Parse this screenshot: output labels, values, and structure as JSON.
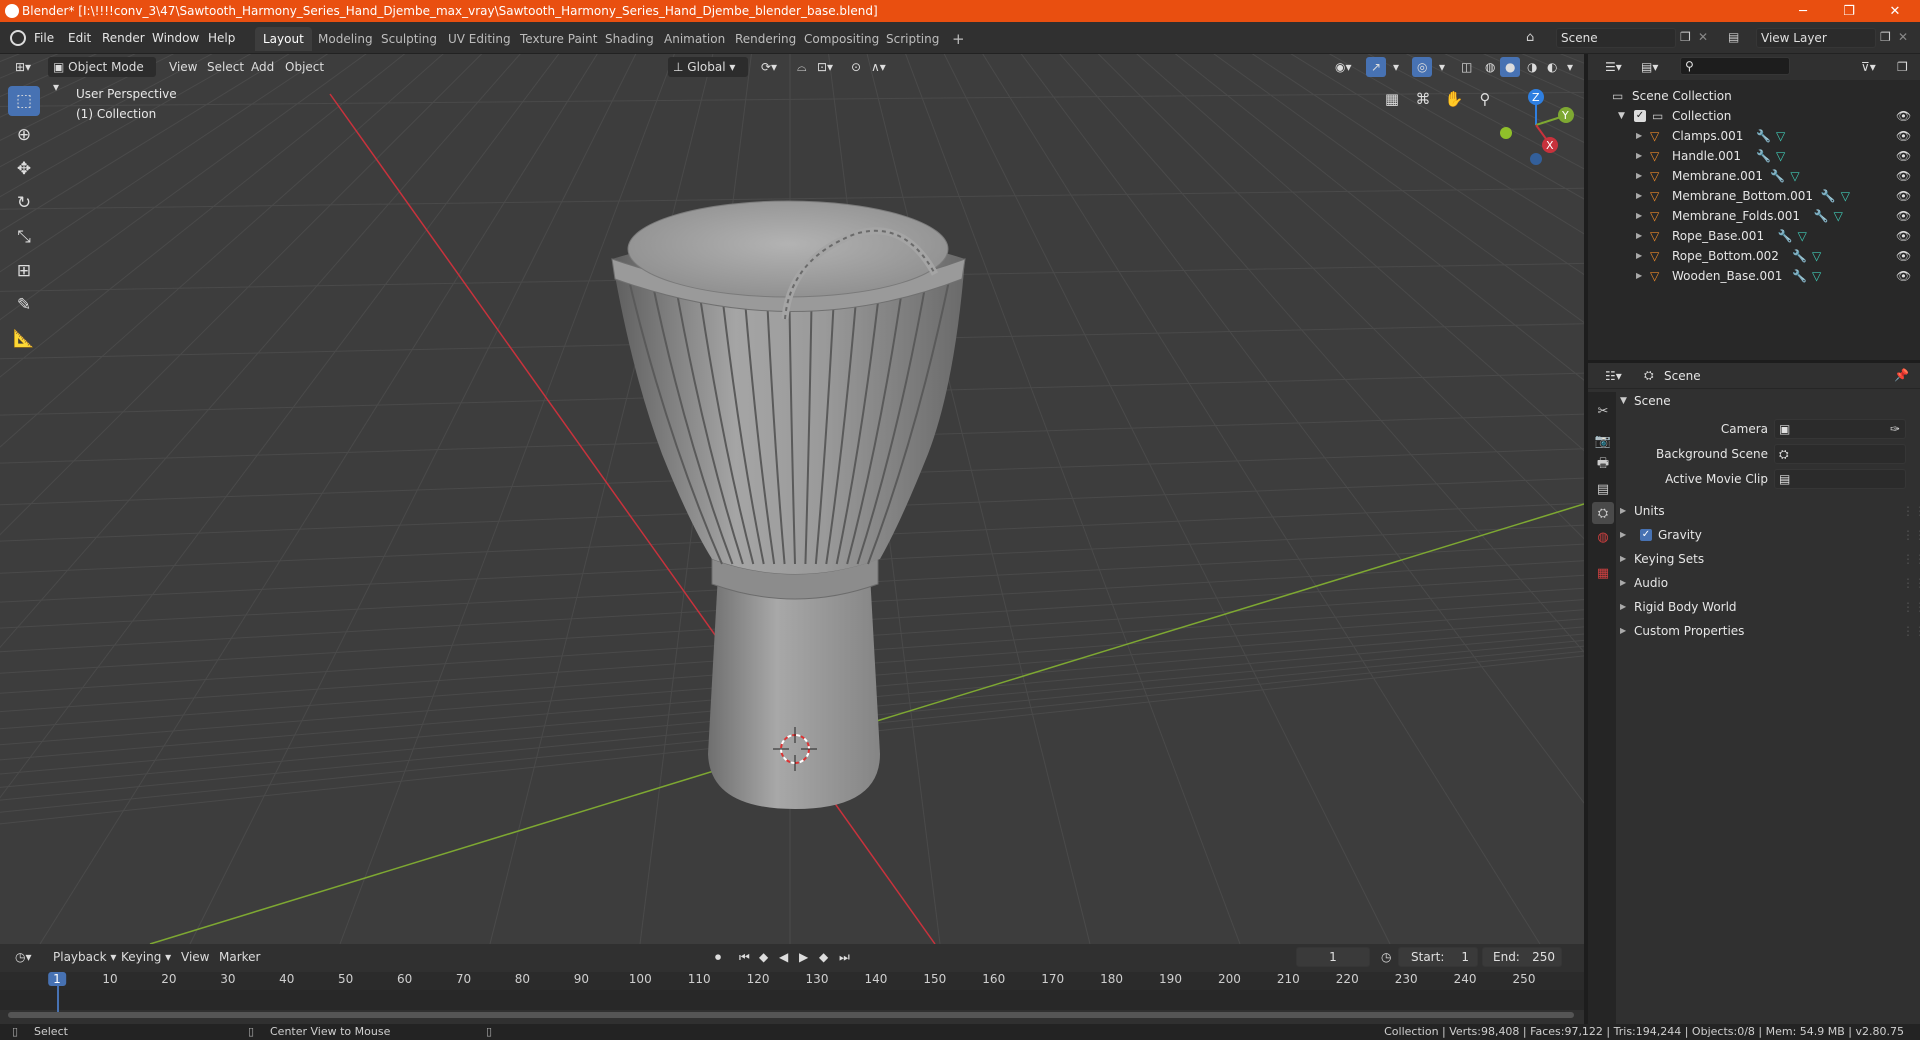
{
  "window": {
    "title": "Blender* [I:\\!!!!conv_3\\47\\Sawtooth_Harmony_Series_Hand_Djembe_max_vray\\Sawtooth_Harmony_Series_Hand_Djembe_blender_base.blend]",
    "minimize": "─",
    "maximize": "❐",
    "close": "✕"
  },
  "menus": [
    "File",
    "Edit",
    "Render",
    "Window",
    "Help"
  ],
  "workspaces": [
    "Layout",
    "Modeling",
    "Sculpting",
    "UV Editing",
    "Texture Paint",
    "Shading",
    "Animation",
    "Rendering",
    "Compositing",
    "Scripting"
  ],
  "add_workspace": "+",
  "scene_field": "Scene",
  "view_layer_field": "View Layer",
  "viewport": {
    "mode": "Object Mode",
    "menus": [
      "View",
      "Select",
      "Add",
      "Object"
    ],
    "transform_orientation": "Global",
    "overlay_line1": "User Perspective",
    "overlay_line2": "(1) Collection",
    "gizmo_labels": {
      "z": "Z",
      "y": "Y",
      "x": "X"
    }
  },
  "outliner": {
    "root": "Scene Collection",
    "collection": "Collection",
    "items": [
      "Clamps.001",
      "Handle.001",
      "Membrane.001",
      "Membrane_Bottom.001",
      "Membrane_Folds.001",
      "Rope_Base.001",
      "Rope_Bottom.002",
      "Wooden_Base.001"
    ]
  },
  "properties": {
    "header": "Scene",
    "panel": "Scene",
    "camera_label": "Camera",
    "background_scene_label": "Background Scene",
    "active_movie_clip_label": "Active Movie Clip",
    "sections": [
      "Units",
      "Gravity",
      "Keying Sets",
      "Audio",
      "Rigid Body World",
      "Custom Properties"
    ],
    "gravity_checked": true
  },
  "timeline": {
    "menus": [
      "Playback",
      "Keying",
      "View",
      "Marker"
    ],
    "current_frame": "1",
    "start_label": "Start:",
    "start": "1",
    "end_label": "End:",
    "end": "250",
    "ticks": [
      "1",
      "10",
      "20",
      "30",
      "40",
      "50",
      "60",
      "70",
      "80",
      "90",
      "100",
      "110",
      "120",
      "130",
      "140",
      "150",
      "160",
      "170",
      "180",
      "190",
      "200",
      "210",
      "220",
      "230",
      "240",
      "250"
    ]
  },
  "statusbar": {
    "left_action": "Select",
    "middle_action": "Center View to Mouse",
    "stats": "Collection | Verts:98,408 | Faces:97,122 | Tris:194,244 | Objects:0/8 | Mem: 54.9 MB | v2.80.75"
  },
  "colors": {
    "titlebar": "#e94f10",
    "accent": "#4772b3",
    "x_axis": "#c8323c",
    "y_axis": "#7ea832",
    "z_axis": "#2f7fe0",
    "mesh_icon": "#e8872a",
    "modifier_icon": "#5a9ae0",
    "data_icon": "#40c8b4"
  }
}
